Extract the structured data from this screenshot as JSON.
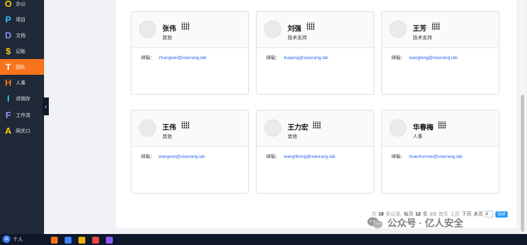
{
  "sidebar": {
    "items": [
      {
        "letter": "O",
        "label": "办公",
        "color": "#facc15"
      },
      {
        "letter": "P",
        "label": "项目",
        "color": "#38bdf8"
      },
      {
        "letter": "D",
        "label": "文档",
        "color": "#818cf8"
      },
      {
        "letter": "$",
        "label": "记账",
        "color": "#facc15"
      },
      {
        "letter": "T",
        "label": "团队",
        "color": "#ffffff"
      },
      {
        "letter": "H",
        "label": "人事",
        "color": "#f97316"
      },
      {
        "letter": "I",
        "label": "进销存",
        "color": "#22d3ee"
      },
      {
        "letter": "F",
        "label": "工作流",
        "color": "#a78bfa"
      },
      {
        "letter": "A",
        "label": "网关口",
        "color": "#facc15"
      }
    ],
    "active_index": 4,
    "collapse_glyph": "‹"
  },
  "user": {
    "avatar_letter": "A",
    "label": "个人"
  },
  "contacts": [
    {
      "name": "张伟",
      "dept": "其他",
      "email_label": "邮箱：",
      "email": "zhangwei@xiaorang.lab"
    },
    {
      "name": "刘强",
      "dept": "技术支持",
      "email_label": "邮箱：",
      "email": "liuqiang@xiaorang.lab"
    },
    {
      "name": "王芳",
      "dept": "技术支持",
      "email_label": "邮箱：",
      "email": "wangfang@xiaorang.lab"
    },
    {
      "name": "王伟",
      "dept": "其他",
      "email_label": "邮箱：",
      "email": "wangwei@xiaorang.lab"
    },
    {
      "name": "王力宏",
      "dept": "其他",
      "email_label": "邮箱：",
      "email": "wanglihong@xiaorang.lab"
    },
    {
      "name": "华春梅",
      "dept": "人事",
      "email_label": "邮箱：",
      "email": "huachunmei@xiaorang.lab"
    }
  ],
  "pager": {
    "total_prefix": "共",
    "total": "18",
    "total_suffix": "条记录,",
    "per_page_prefix": "每页",
    "per_page": "12",
    "per_page_suffix": "条",
    "page_info": "1/2",
    "first": "首页",
    "prev": "上页",
    "next": "下页",
    "last": "末页",
    "page_input": "1",
    "go": "Go!"
  },
  "watermark": {
    "text": "公众号 · 亿人安全"
  },
  "colors": {
    "accent": "#f7731c",
    "link": "#2563eb",
    "go_button": "#2b9af3"
  }
}
